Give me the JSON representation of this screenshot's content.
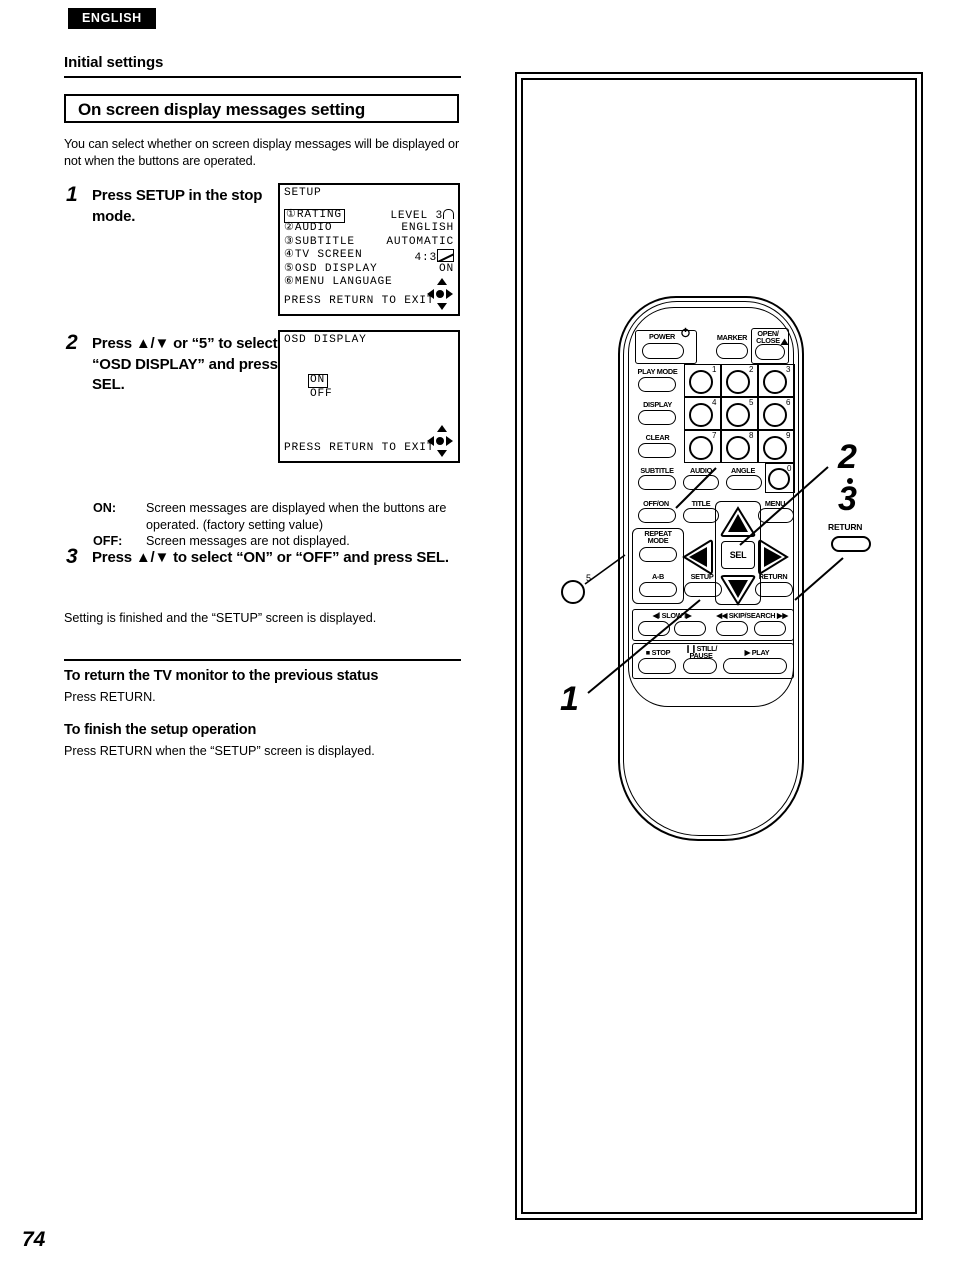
{
  "header": {
    "language_tag": "ENGLISH",
    "chapter_title": "Initial settings",
    "section_title": "On screen display messages setting"
  },
  "intro": "You can select whether on screen display messages will be displayed or not when the buttons are operated.",
  "steps": [
    {
      "number": "1",
      "text": "Press SETUP in the stop mode."
    },
    {
      "number": "2",
      "text": "Press ▲/▼ or “5” to select “OSD DISPLAY” and press SEL."
    },
    {
      "number": "3",
      "text": "Press ▲/▼ to select “ON” or “OFF” and press SEL."
    }
  ],
  "definitions": [
    {
      "term": "ON:",
      "desc": "Screen messages are displayed when the buttons are operated. (factory setting value)"
    },
    {
      "term": "OFF:",
      "desc": "Screen messages are not displayed."
    }
  ],
  "step3_note": "Setting is finished and the “SETUP” screen is displayed.",
  "sub_sections": [
    {
      "heading": "To return the TV monitor to the previous status",
      "body": "Press RETURN."
    },
    {
      "heading": "To finish the setup operation",
      "body": "Press RETURN when the “SETUP” screen is displayed."
    }
  ],
  "osd_screens": [
    {
      "title": "SETUP",
      "rows": [
        {
          "label": "①RATING",
          "value": "LEVEL 3",
          "highlighted": true,
          "icon": "lock-icon"
        },
        {
          "label": "②AUDIO",
          "value": "ENGLISH",
          "highlighted": false,
          "icon": ""
        },
        {
          "label": "③SUBTITLE",
          "value": "AUTOMATIC",
          "highlighted": false,
          "icon": ""
        },
        {
          "label": "④TV SCREEN",
          "value": "4:3",
          "highlighted": false,
          "icon": "tv-screen-icon"
        },
        {
          "label": "⑤OSD DISPLAY",
          "value": "ON",
          "highlighted": false,
          "icon": ""
        },
        {
          "label": "⑥MENU LANGUAGE",
          "value": "",
          "highlighted": false,
          "icon": ""
        }
      ],
      "footer": "PRESS RETURN TO EXIT"
    },
    {
      "title": "OSD DISPLAY",
      "options": [
        {
          "label": "ON",
          "highlighted": true
        },
        {
          "label": "OFF",
          "highlighted": false
        }
      ],
      "footer": "PRESS RETURN TO EXIT"
    }
  ],
  "remote": {
    "buttons": {
      "power": "POWER",
      "marker": "MARKER",
      "open_close": "OPEN/\nCLOSE",
      "play_mode": "PLAY MODE",
      "display": "DISPLAY",
      "clear": "CLEAR",
      "subtitle": "SUBTITLE",
      "audio": "AUDIO",
      "angle": "ANGLE",
      "off_on": "OFF/ON",
      "title": "TITLE",
      "menu": "MENU",
      "repeat_mode": "REPEAT\nMODE",
      "a_b": "A-B",
      "setup": "SETUP",
      "sel": "SEL",
      "return": "RETURN",
      "slow": "SLOW",
      "skip_search": "SKIP/SEARCH",
      "stop": "STOP",
      "still_pause": "STILL/\nPAUSE",
      "play": "PLAY"
    },
    "number_keys": [
      "1",
      "2",
      "3",
      "4",
      "5",
      "6",
      "7",
      "8",
      "9",
      "0"
    ],
    "detail_number": "5",
    "standalone_return": "RETURN",
    "callouts": {
      "one": "1",
      "two": "2",
      "three": "3"
    }
  },
  "page_number": "74"
}
